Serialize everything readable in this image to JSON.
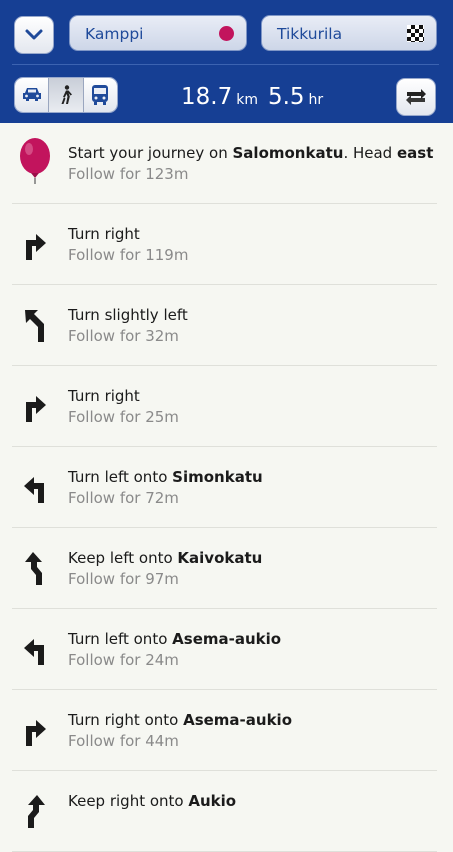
{
  "route": {
    "origin": "Kamppi",
    "destination": "Tikkurila",
    "distance_value": "18.7",
    "distance_unit": "km",
    "time_value": "5.5",
    "time_unit": "hr"
  },
  "modes": [
    {
      "name": "car",
      "icon": "car-icon",
      "active": false
    },
    {
      "name": "walk",
      "icon": "walking-person-icon",
      "active": true
    },
    {
      "name": "bus",
      "icon": "bus-icon",
      "active": false
    }
  ],
  "colors": {
    "header_bg": "#163f94",
    "destination_marker": "#c2145d",
    "list_bg": "#f6f7f2"
  },
  "steps": [
    {
      "icon": "start-pin-icon",
      "prefix": "Start your journey on ",
      "street": "Salomonkatu",
      "middle": ". Head ",
      "direction": "east",
      "detail": "Follow for 123m"
    },
    {
      "icon": "turn-right-icon",
      "prefix": "Turn right",
      "street": "",
      "middle": "",
      "direction": "",
      "detail": "Follow for 119m"
    },
    {
      "icon": "turn-slight-left-icon",
      "prefix": "Turn slightly left",
      "street": "",
      "middle": "",
      "direction": "",
      "detail": "Follow for 32m"
    },
    {
      "icon": "turn-right-icon",
      "prefix": "Turn right",
      "street": "",
      "middle": "",
      "direction": "",
      "detail": "Follow for 25m"
    },
    {
      "icon": "turn-left-icon",
      "prefix": "Turn left onto ",
      "street": "Simonkatu",
      "middle": "",
      "direction": "",
      "detail": "Follow for 72m"
    },
    {
      "icon": "keep-left-icon",
      "prefix": "Keep left onto ",
      "street": "Kaivokatu",
      "middle": "",
      "direction": "",
      "detail": "Follow for 97m"
    },
    {
      "icon": "turn-left-icon",
      "prefix": "Turn left onto ",
      "street": "Asema-aukio",
      "middle": "",
      "direction": "",
      "detail": "Follow for 24m"
    },
    {
      "icon": "turn-right-icon",
      "prefix": "Turn right onto ",
      "street": "Asema-aukio",
      "middle": "",
      "direction": "",
      "detail": "Follow for 44m"
    },
    {
      "icon": "keep-right-icon",
      "prefix": "Keep right onto ",
      "street": "Aukio",
      "middle": "",
      "direction": "",
      "detail": ""
    }
  ]
}
